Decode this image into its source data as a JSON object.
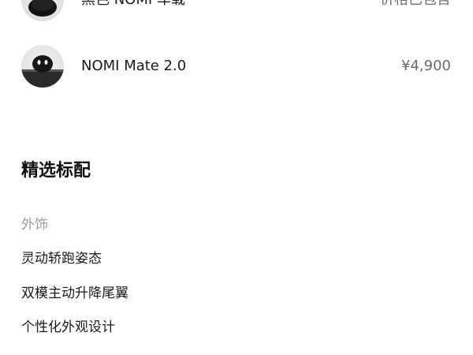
{
  "options": [
    {
      "name": "黑色 NOMI 车载",
      "price": "价格已包含",
      "thumb_icon": "nomi-device-icon"
    },
    {
      "name": "NOMI Mate 2.0",
      "price": "¥4,900",
      "thumb_icon": "nomi-mate-icon"
    }
  ],
  "standard_features": {
    "title": "精选标配",
    "category": "外饰",
    "items": [
      "灵动轿跑姿态",
      "双模主动升降尾翼",
      "个性化外观设计"
    ]
  },
  "colors": {
    "text_primary": "#1a1a1a",
    "text_secondary": "#6b6b6b",
    "text_muted": "#9a9a9a",
    "background": "#ffffff"
  }
}
